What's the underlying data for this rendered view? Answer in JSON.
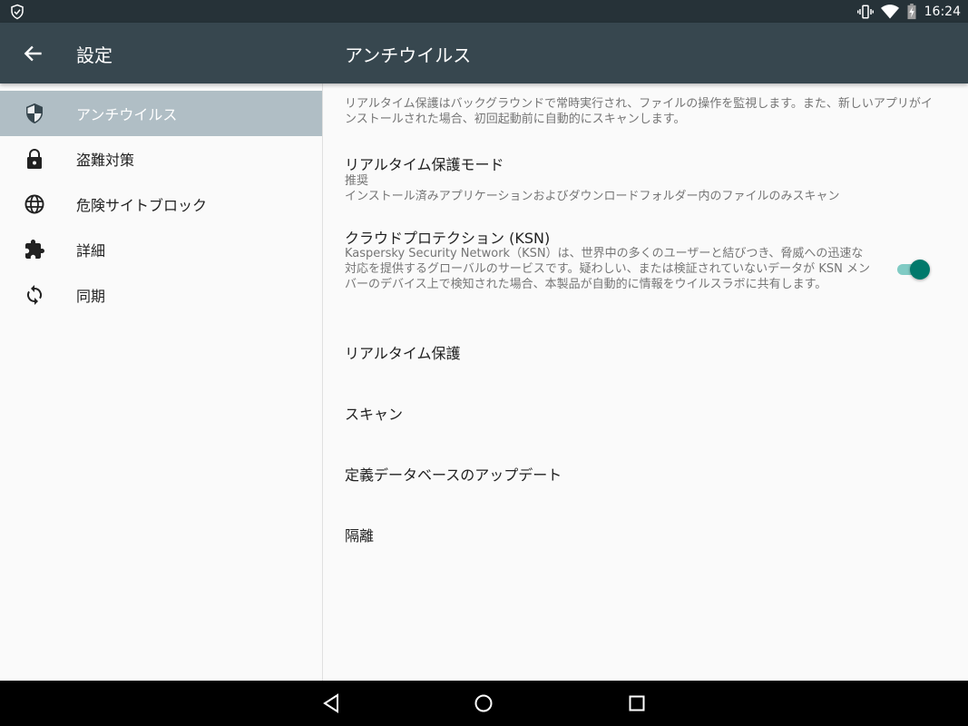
{
  "status_bar": {
    "time": "16:24",
    "icons": [
      "shield-check-icon",
      "vibrate-icon",
      "wifi-icon",
      "battery-charging-icon"
    ]
  },
  "app_bar": {
    "title_left": "設定",
    "title_right": "アンチウイルス",
    "back_icon": "arrow-back-icon"
  },
  "sidebar": {
    "items": [
      {
        "label": "アンチウイルス",
        "icon": "shield-icon",
        "active": true
      },
      {
        "label": "盗難対策",
        "icon": "lock-icon",
        "active": false
      },
      {
        "label": "危険サイトブロック",
        "icon": "globe-icon",
        "active": false
      },
      {
        "label": "詳細",
        "icon": "puzzle-icon",
        "active": false
      },
      {
        "label": "同期",
        "icon": "sync-icon",
        "active": false
      }
    ]
  },
  "content": {
    "description": "リアルタイム保護はバックグラウンドで常時実行され、ファイルの操作を監視します。また、新しいアプリがインストールされた場合、初回起動前に自動的にスキャンします。",
    "realtime_mode": {
      "title": "リアルタイム保護モード",
      "value": "推奨",
      "detail": "インストール済みアプリケーションおよびダウンロードフォルダー内のファイルのみスキャン"
    },
    "ksn": {
      "title": "クラウドプロテクション (KSN)",
      "description": "Kaspersky Security Network（KSN）は、世界中の多くのユーザーと結びつき、脅威への迅速な対応を提供するグローバルのサービスです。疑わしい、または検証されていないデータが KSN メンバーのデバイス上で検知された場合、本製品が自動的に情報をウイルスラボに共有します。",
      "enabled": true
    },
    "items": [
      {
        "label": "リアルタイム保護"
      },
      {
        "label": "スキャン"
      },
      {
        "label": "定義データベースのアップデート"
      },
      {
        "label": "隔離"
      }
    ]
  },
  "nav_bar": {
    "buttons": [
      "back-triangle-icon",
      "home-circle-icon",
      "recents-square-icon"
    ]
  },
  "colors": {
    "status_bar": "#263238",
    "app_bar": "#37474f",
    "active_item": "#b0bec5",
    "toggle_thumb": "#00796b",
    "toggle_track": "#80cbc4"
  }
}
